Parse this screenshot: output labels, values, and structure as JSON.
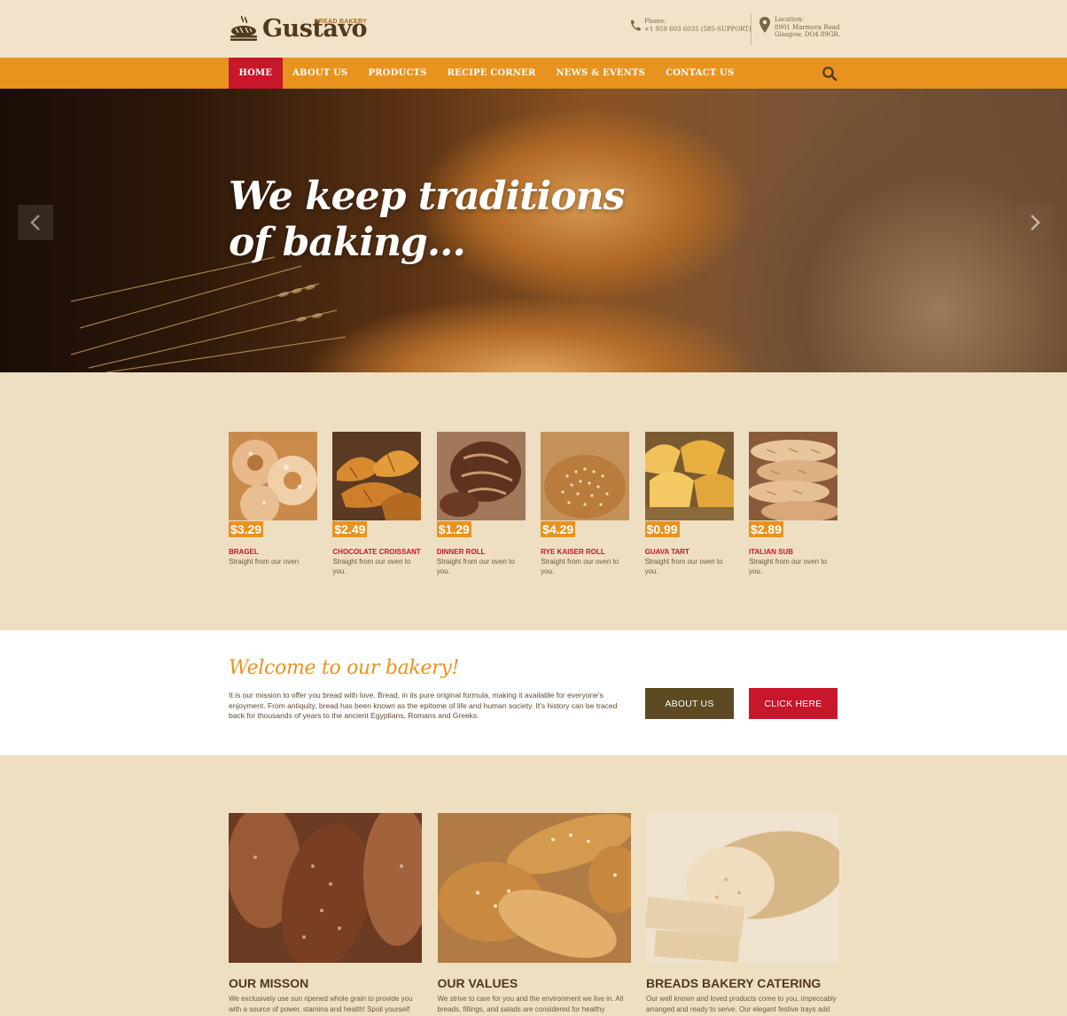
{
  "brand": {
    "name": "Gustavo",
    "tagline": "BREAD BAKERY"
  },
  "contact": {
    "phone_label": "Phone:",
    "phone_value": "+1 959 603 6035 (585-SUPPORT)",
    "location_label": "Location:",
    "location_line1": "8901 Marmora Road",
    "location_line2": "Glasgow, DO4 89GR."
  },
  "nav": {
    "items": [
      "HOME",
      "ABOUT US",
      "PRODUCTS",
      "RECIPE CORNER",
      "NEWS & EVENTS",
      "CONTACT US"
    ],
    "active": "HOME"
  },
  "hero": {
    "title_line1": "We keep traditions",
    "title_line2": "of baking..."
  },
  "products": [
    {
      "price": "$3.29",
      "name": "BRAGEL",
      "desc": "Straight from our oven"
    },
    {
      "price": "$2.49",
      "name": "CHOCOLATE CROISSANT",
      "desc": "Straight from our oven to you."
    },
    {
      "price": "$1.29",
      "name": "DINNER ROLL",
      "desc": "Straight from our oven to you."
    },
    {
      "price": "$4.29",
      "name": "RYE KAISER ROLL",
      "desc": "Straight from our oven to you."
    },
    {
      "price": "$0.99",
      "name": "GUAVA TART",
      "desc": "Straight from our oven to you."
    },
    {
      "price": "$2.89",
      "name": "ITALIAN SUB",
      "desc": "Straight from our oven to you."
    }
  ],
  "welcome": {
    "title": "Welcome to our bakery!",
    "text": "It is our mission to offer you bread with love. Bread, in its pure original formula, making it available for everyone's enjoyment. From antiquity, bread has been known as the epitome of life and human society. It's history can be traced back for thousands of years to the ancient Egyptians, Romans and Greeks.",
    "about_button": "ABOUT US",
    "click_button": "CLICK HERE"
  },
  "features": [
    {
      "title": "OUR MISSON",
      "desc": "We exclusively use sun ripened whole grain to provide you with a source of power, stamina and health! Spoil yourself"
    },
    {
      "title": "OUR VALUES",
      "desc": "We strive to care for you and the environment we live in. All breads, fillings, and salads are considered for healthy"
    },
    {
      "title": "BREADS BAKERY CATERING",
      "desc": "Our well known and loved products come to you, impeccably arranged and ready to serve. Our elegant festive trays add"
    }
  ],
  "colors": {
    "accent_orange": "#e9931f",
    "accent_red": "#c8162b",
    "brown_button": "#5d4a22",
    "background": "#efdfc2"
  },
  "icons": [
    "bread-logo-icon",
    "phone-icon",
    "location-pin-icon",
    "search-icon",
    "chevron-left-icon",
    "chevron-right-icon"
  ]
}
